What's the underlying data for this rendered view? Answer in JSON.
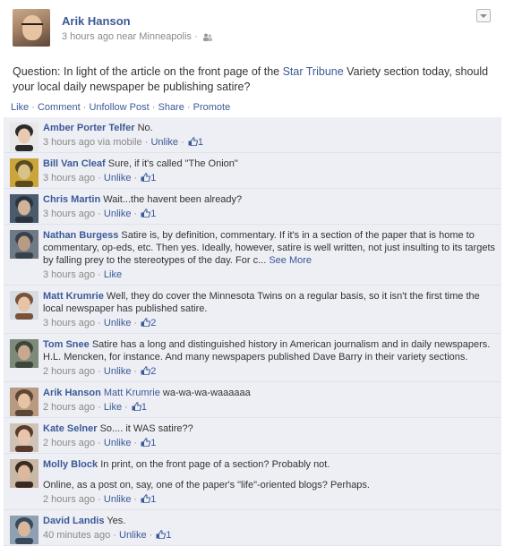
{
  "post": {
    "author": "Arik Hanson",
    "meta": "3 hours ago near Minneapolis ·",
    "body_before": "Question: In light of the article on the front page of the ",
    "body_link": "Star Tribune",
    "body_after": " Variety section today, should your local daily newspaper be publishing satire?",
    "menu_icon": "chevron-down-icon",
    "audience_icon": "friends-icon"
  },
  "actions": {
    "like": "Like",
    "comment": "Comment",
    "unfollow": "Unfollow Post",
    "share": "Share",
    "promote": "Promote",
    "separator": " · "
  },
  "comments": [
    {
      "name": "Amber Porter Telfer",
      "text": "No.",
      "time": "3 hours ago via mobile",
      "action": "Unlike",
      "likes": "1"
    },
    {
      "name": "Bill Van Cleaf",
      "text": "Sure, if it's called \"The Onion\"",
      "time": "3 hours ago",
      "action": "Unlike",
      "likes": "1"
    },
    {
      "name": "Chris Martin",
      "text": "Wait...the havent been already?",
      "time": "3 hours ago",
      "action": "Unlike",
      "likes": "1"
    },
    {
      "name": "Nathan Burgess",
      "text": "Satire is, by definition, commentary. If it's in a section of the paper that is home to commentary, op-eds, etc. Then yes. Ideally, however, satire is well written, not just insulting to its targets by falling prey to the stereotypes of the day. For c...",
      "see_more": "See More",
      "time": "3 hours ago",
      "action": "Like",
      "likes": ""
    },
    {
      "name": "Matt Krumrie",
      "text": "Well, they do cover the Minnesota Twins on a regular basis, so it isn't the first time the local newspaper has published satire.",
      "time": "3 hours ago",
      "action": "Unlike",
      "likes": "2"
    },
    {
      "name": "Tom Snee",
      "text": "Satire has a long and distinguished history in American journalism and in daily newspapers. H.L. Mencken, for instance. And many newspapers published Dave Barry in their variety sections.",
      "time": "2 hours ago",
      "action": "Unlike",
      "likes": "2"
    },
    {
      "name": "Arik Hanson",
      "tag": "Matt Krumrie",
      "text": "wa-wa-wa-waaaaaa",
      "time": "2 hours ago",
      "action": "Like",
      "likes": "1"
    },
    {
      "name": "Kate Selner",
      "text": "So.... it WAS satire??",
      "time": "2 hours ago",
      "action": "Unlike",
      "likes": "1"
    },
    {
      "name": "Molly Block",
      "text": "In print, on the front page of a section? Probably not.",
      "text2": "Online, as a post on, say, one of the paper's \"life\"-oriented blogs? Perhaps.",
      "time": "2 hours ago",
      "action": "Unlike",
      "likes": "1"
    },
    {
      "name": "David Landis",
      "text": "Yes.",
      "time": "40 minutes ago",
      "action": "Unlike",
      "likes": "1"
    }
  ],
  "colors": {
    "link": "#3b5998",
    "comment_bg": "#edeff4",
    "meta_text": "#8a8a8a"
  }
}
